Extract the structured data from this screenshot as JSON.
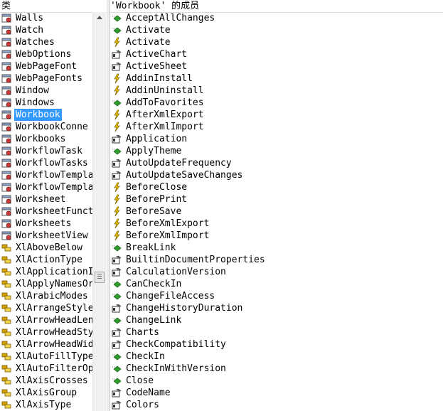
{
  "left_pane": {
    "header": "类",
    "selected_index": 8,
    "items": [
      {
        "label": "Walls",
        "icon": "class-icon"
      },
      {
        "label": "Watch",
        "icon": "class-icon"
      },
      {
        "label": "Watches",
        "icon": "class-icon"
      },
      {
        "label": "WebOptions",
        "icon": "class-icon"
      },
      {
        "label": "WebPageFont",
        "icon": "class-icon"
      },
      {
        "label": "WebPageFonts",
        "icon": "class-icon"
      },
      {
        "label": "Window",
        "icon": "class-icon"
      },
      {
        "label": "Windows",
        "icon": "class-icon"
      },
      {
        "label": "Workbook",
        "icon": "class-icon"
      },
      {
        "label": "WorkbookConne",
        "icon": "class-icon"
      },
      {
        "label": "Workbooks",
        "icon": "class-icon"
      },
      {
        "label": "WorkflowTask",
        "icon": "class-icon"
      },
      {
        "label": "WorkflowTasks",
        "icon": "class-icon"
      },
      {
        "label": "WorkflowTempla",
        "icon": "class-icon"
      },
      {
        "label": "WorkflowTempla",
        "icon": "class-icon"
      },
      {
        "label": "Worksheet",
        "icon": "class-icon"
      },
      {
        "label": "WorksheetFunct",
        "icon": "class-icon"
      },
      {
        "label": "Worksheets",
        "icon": "class-icon"
      },
      {
        "label": "WorksheetView",
        "icon": "class-icon"
      },
      {
        "label": "XlAboveBelow",
        "icon": "enum-icon"
      },
      {
        "label": "XlActionType",
        "icon": "enum-icon"
      },
      {
        "label": "XlApplicationI",
        "icon": "enum-icon"
      },
      {
        "label": "XlApplyNamesOr",
        "icon": "enum-icon"
      },
      {
        "label": "XlArabicModes",
        "icon": "enum-icon"
      },
      {
        "label": "XlArrangeStyle",
        "icon": "enum-icon"
      },
      {
        "label": "XlArrowHeadLen",
        "icon": "enum-icon"
      },
      {
        "label": "XlArrowHeadSty",
        "icon": "enum-icon"
      },
      {
        "label": "XlArrowHeadWid",
        "icon": "enum-icon"
      },
      {
        "label": "XlAutoFillType",
        "icon": "enum-icon"
      },
      {
        "label": "XlAutoFilterOp",
        "icon": "enum-icon"
      },
      {
        "label": "XlAxisCrosses",
        "icon": "enum-icon"
      },
      {
        "label": "XlAxisGroup",
        "icon": "enum-icon"
      },
      {
        "label": "XlAxisType",
        "icon": "enum-icon"
      }
    ]
  },
  "right_pane": {
    "header": "'Workbook' 的成员",
    "items": [
      {
        "label": "AcceptAllChanges",
        "icon": "method-icon"
      },
      {
        "label": "Activate",
        "icon": "method-icon"
      },
      {
        "label": "Activate",
        "icon": "event-icon"
      },
      {
        "label": "ActiveChart",
        "icon": "property-icon"
      },
      {
        "label": "ActiveSheet",
        "icon": "property-icon"
      },
      {
        "label": "AddinInstall",
        "icon": "event-icon"
      },
      {
        "label": "AddinUninstall",
        "icon": "event-icon"
      },
      {
        "label": "AddToFavorites",
        "icon": "method-icon"
      },
      {
        "label": "AfterXmlExport",
        "icon": "event-icon"
      },
      {
        "label": "AfterXmlImport",
        "icon": "event-icon"
      },
      {
        "label": "Application",
        "icon": "property-icon"
      },
      {
        "label": "ApplyTheme",
        "icon": "method-icon"
      },
      {
        "label": "AutoUpdateFrequency",
        "icon": "property-icon"
      },
      {
        "label": "AutoUpdateSaveChanges",
        "icon": "property-icon"
      },
      {
        "label": "BeforeClose",
        "icon": "event-icon"
      },
      {
        "label": "BeforePrint",
        "icon": "event-icon"
      },
      {
        "label": "BeforeSave",
        "icon": "event-icon"
      },
      {
        "label": "BeforeXmlExport",
        "icon": "event-icon"
      },
      {
        "label": "BeforeXmlImport",
        "icon": "event-icon"
      },
      {
        "label": "BreakLink",
        "icon": "method-icon"
      },
      {
        "label": "BuiltinDocumentProperties",
        "icon": "property-icon"
      },
      {
        "label": "CalculationVersion",
        "icon": "property-icon"
      },
      {
        "label": "CanCheckIn",
        "icon": "method-icon"
      },
      {
        "label": "ChangeFileAccess",
        "icon": "method-icon"
      },
      {
        "label": "ChangeHistoryDuration",
        "icon": "property-icon"
      },
      {
        "label": "ChangeLink",
        "icon": "method-icon"
      },
      {
        "label": "Charts",
        "icon": "property-icon"
      },
      {
        "label": "CheckCompatibility",
        "icon": "property-icon"
      },
      {
        "label": "CheckIn",
        "icon": "method-icon"
      },
      {
        "label": "CheckInWithVersion",
        "icon": "method-icon"
      },
      {
        "label": "Close",
        "icon": "method-icon"
      },
      {
        "label": "CodeName",
        "icon": "property-icon"
      },
      {
        "label": "Colors",
        "icon": "property-icon"
      }
    ]
  },
  "colors": {
    "selection": "#3399ff",
    "method_green": "#2e9d2e",
    "event_yellow": "#e8c000",
    "class_red": "#c83a3a",
    "enum_gold": "#d8a400"
  }
}
